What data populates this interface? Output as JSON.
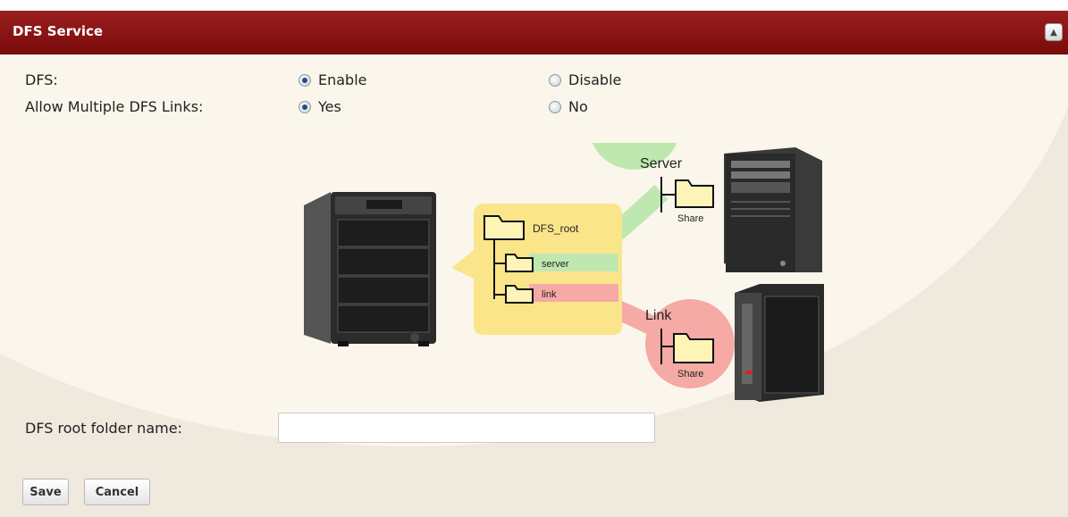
{
  "panel": {
    "title": "DFS Service"
  },
  "form": {
    "dfs": {
      "label": "DFS:",
      "options": [
        {
          "label": "Enable",
          "selected": true
        },
        {
          "label": "Disable",
          "selected": false
        }
      ]
    },
    "multi_links": {
      "label": "Allow Multiple DFS Links:",
      "options": [
        {
          "label": "Yes",
          "selected": true
        },
        {
          "label": "No",
          "selected": false
        }
      ]
    },
    "root_folder": {
      "label": "DFS root folder name:",
      "value": ""
    }
  },
  "diagram": {
    "root_folder": "DFS_root",
    "subfolder_server": "server",
    "subfolder_link": "link",
    "server_title": "Server",
    "link_title": "Link",
    "share_label": "Share"
  },
  "buttons": {
    "save": "Save",
    "cancel": "Cancel"
  },
  "colors": {
    "titlebar": "#8b1414",
    "green_bubble": "#bfe8b0",
    "red_bubble": "#f5aaa5",
    "yellow_panel": "#fbe58a"
  }
}
